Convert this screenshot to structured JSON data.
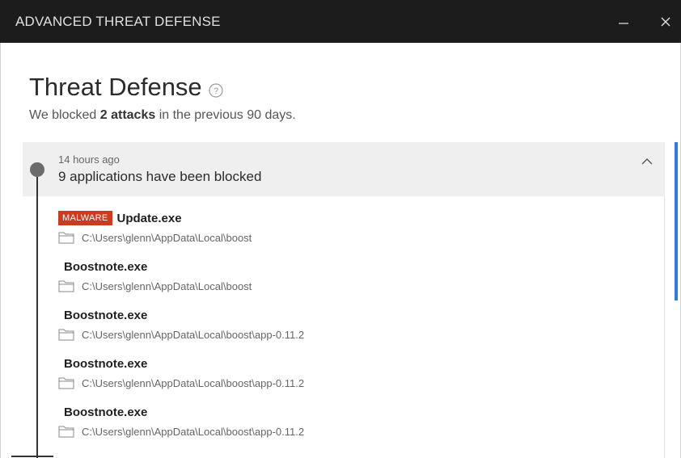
{
  "window": {
    "title": "ADVANCED THREAT DEFENSE",
    "minimize_icon": "minimize-icon",
    "close_icon": "close-icon"
  },
  "header": {
    "title": "Threat Defense",
    "help_icon": "help-icon",
    "summary_prefix": "We blocked ",
    "summary_count": "2 attacks",
    "summary_suffix": " in the previous 90 days."
  },
  "event": {
    "time": "14 hours ago",
    "description": "9 applications have been blocked",
    "collapse_icon": "chevron-up-icon"
  },
  "apps": [
    {
      "badge": "MALWARE",
      "name": "Update.exe",
      "path": "C:\\Users\\glenn\\AppData\\Local\\boost"
    },
    {
      "badge": "",
      "name": "Boostnote.exe",
      "path": "C:\\Users\\glenn\\AppData\\Local\\boost"
    },
    {
      "badge": "",
      "name": "Boostnote.exe",
      "path": "C:\\Users\\glenn\\AppData\\Local\\boost\\app-0.11.2"
    },
    {
      "badge": "",
      "name": "Boostnote.exe",
      "path": "C:\\Users\\glenn\\AppData\\Local\\boost\\app-0.11.2"
    },
    {
      "badge": "",
      "name": "Boostnote.exe",
      "path": "C:\\Users\\glenn\\AppData\\Local\\boost\\app-0.11.2"
    }
  ],
  "colors": {
    "titlebar": "#1c1c1c",
    "malware_badge": "#cc3b1f",
    "scroll_accent": "#2f7cd3",
    "event_header_bg": "#efefef"
  }
}
